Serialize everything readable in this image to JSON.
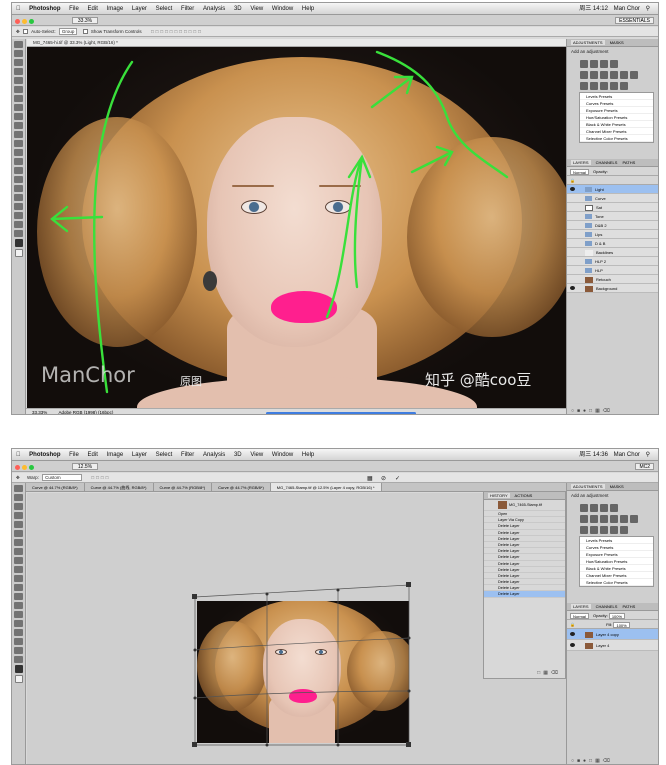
{
  "shot1": {
    "menubar": {
      "app": "Photoshop",
      "items": [
        "File",
        "Edit",
        "Image",
        "Layer",
        "Select",
        "Filter",
        "Analysis",
        "3D",
        "View",
        "Window",
        "Help"
      ],
      "time": "周三 14:12",
      "user": "Man Chor"
    },
    "appbar": {
      "zoom": "33.3%",
      "workspace": "ESSENTIALS"
    },
    "options": {
      "auto_select": "Auto-Select:",
      "group": "Group",
      "transform": "Show Transform Controls"
    },
    "doc_title": "MG_7465-hi.tif @ 33.3% (Light, RGB/16) *",
    "status": {
      "zoom": "33.33%",
      "info": "Adobe RGB (1998) (16bpc)"
    },
    "watermark_left": "ManChor",
    "watermark_orig": "原图",
    "watermark_right": "知乎 @酷coo豆",
    "adjustments": {
      "tabs": [
        "ADJUSTMENTS",
        "MASKS"
      ],
      "title": "Add an adjustment",
      "presets": [
        "Levels Presets",
        "Curves Presets",
        "Exposure Presets",
        "Hue/Saturation Presets",
        "Black & White Presets",
        "Channel Mixer Presets",
        "Selective Color Presets"
      ]
    },
    "layers": {
      "tabs": [
        "LAYERS",
        "CHANNELS",
        "PATHS"
      ],
      "blend": "Normal",
      "opacity_label": "Opacity:",
      "items": [
        "Light",
        "Curve",
        "Sat",
        "Tone",
        "D&B 2",
        "Lips",
        "D & B",
        "Backlines",
        "HLP 2",
        "HLP",
        "Retouch",
        "Background"
      ]
    }
  },
  "shot2": {
    "menubar": {
      "app": "Photoshop",
      "items": [
        "File",
        "Edit",
        "Image",
        "Layer",
        "Select",
        "Filter",
        "Analysis",
        "3D",
        "View",
        "Window",
        "Help"
      ],
      "time": "周三 14:36",
      "user": "Man Chor"
    },
    "appbar": {
      "zoom": "12.5%",
      "workspace": "MC2"
    },
    "options": {
      "warp": "Warp:",
      "mode": "Custom"
    },
    "tabs": [
      "Curve @ 44.7% (RGB/8*)",
      "Curve @ 44.7% (曲线, RGB/8*)",
      "Curve @ 44.7% (RGB/8*)",
      "Curve @ 44.7% (RGB/8*)",
      "MG_7465-Stamp.tif @ 12.5% (Layer 4 copy, RGB/16) *"
    ],
    "history": {
      "tabs": [
        "HISTORY",
        "ACTIONS"
      ],
      "snapshot": "MG_7465-Stamp.tif",
      "items": [
        "Open",
        "Layer Via Copy",
        "Delete Layer",
        "Delete Layer",
        "Delete Layer",
        "Delete Layer",
        "Delete Layer",
        "Delete Layer",
        "Delete Layer",
        "Delete Layer",
        "Delete Layer",
        "Delete Layer",
        "Delete Layer",
        "Delete Layer"
      ]
    },
    "adjustments": {
      "tabs": [
        "ADJUSTMENTS",
        "MASKS"
      ],
      "title": "Add an adjustment",
      "presets": [
        "Levels Presets",
        "Curves Presets",
        "Exposure Presets",
        "Hue/Saturation Presets",
        "Black & White Presets",
        "Channel Mixer Presets",
        "Selective Color Presets"
      ]
    },
    "layers": {
      "tabs": [
        "LAYERS",
        "CHANNELS",
        "PATHS"
      ],
      "blend": "Normal",
      "opacity_label": "Opacity:",
      "opacity": "100%",
      "fill_label": "Fill:",
      "fill": "100%",
      "items": [
        "Layer 4 copy",
        "Layer 4"
      ]
    }
  },
  "colors": {
    "lips": "#ff1f8e",
    "annotation": "#39e03b",
    "selection": "#9cc0f0"
  }
}
